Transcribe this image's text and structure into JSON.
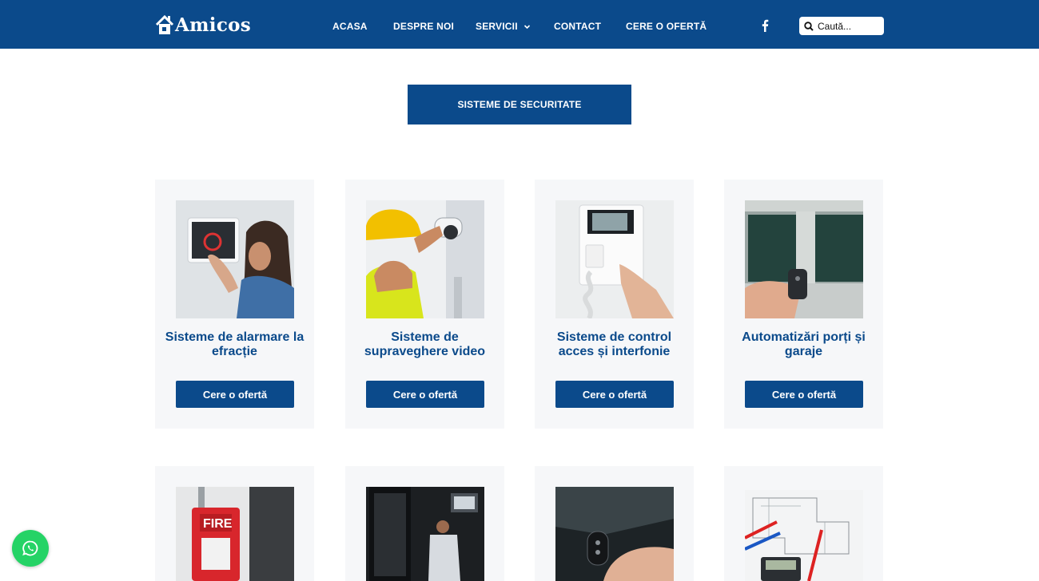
{
  "header": {
    "brand": "Amicos",
    "nav": [
      {
        "label": "ACASA"
      },
      {
        "label": "DESPRE NOI"
      },
      {
        "label": "SERVICII"
      },
      {
        "label": "CONTACT"
      },
      {
        "label": "CERE O OFERTĂ"
      }
    ],
    "search": {
      "placeholder": "Caută..."
    },
    "social_icon": "facebook-icon"
  },
  "section": {
    "title": "SISTEME DE SECURITATE"
  },
  "cards": [
    {
      "title": "Sisteme de alarmare la efracție",
      "cta": "Cere o ofertă"
    },
    {
      "title": "Sisteme de supraveghere video",
      "cta": "Cere o ofertă"
    },
    {
      "title": "Sisteme de control acces și interfonie",
      "cta": "Cere o ofertă"
    },
    {
      "title": "Automatizări porți și garaje",
      "cta": "Cere o ofertă"
    }
  ],
  "cards_row2": [
    {
      "image": "fire-alarm-image"
    },
    {
      "image": "server-rack-image"
    },
    {
      "image": "car-key-image"
    },
    {
      "image": "electrical-plans-image"
    }
  ],
  "colors": {
    "brand": "#0b4a8b",
    "card_bg": "#f6f7f9",
    "whatsapp": "#25d366"
  }
}
